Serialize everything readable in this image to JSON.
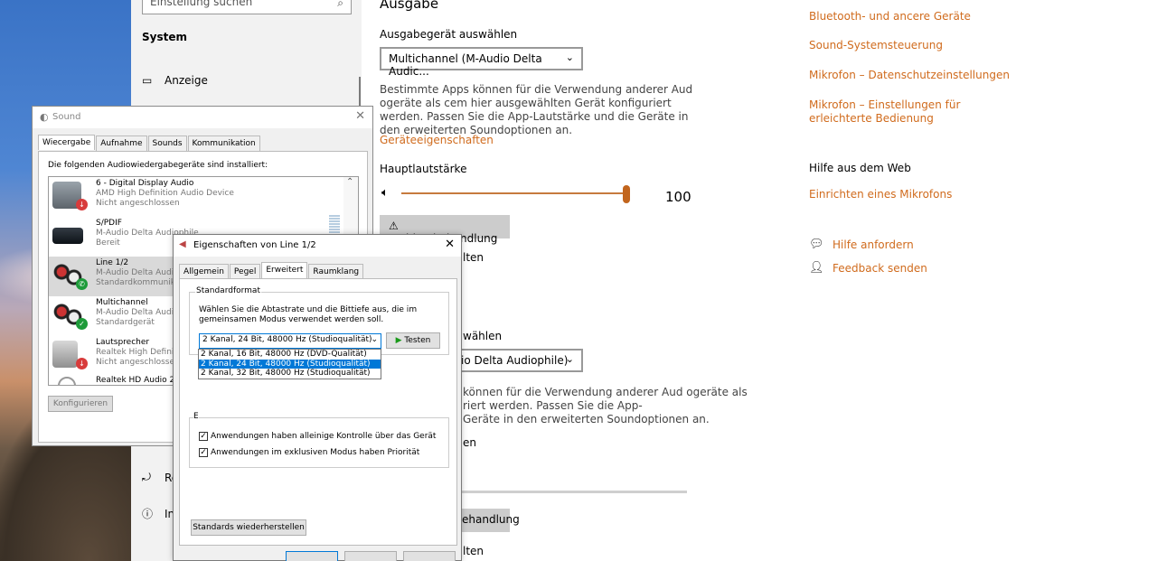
{
  "settings_nav": {
    "search_placeholder": "Einstellung suchen",
    "section": "System",
    "items": [
      {
        "label": "Anzeige",
        "icon": "monitor-icon"
      },
      {
        "label": "Re",
        "icon": "refresh-icon"
      },
      {
        "label": "In",
        "icon": "info-icon"
      }
    ]
  },
  "settings_main": {
    "heading": "Ausgabe",
    "output_device_label": "Ausgabegerät auswählen",
    "output_device_value": "Multichannel (M-Audio Delta Audic...",
    "apps_text": "Bestimmte Apps können für die Verwendung anderer Aud ogeräte als cem hier ausgewählten Gerät konfiguriert werden. Passen Sie die App-Lautstärke und die Geräte in den erweiterten Soundoptionen an.",
    "device_props_link": "Geräteeigenschaften",
    "master_volume_label": "Hauptlautstärke",
    "master_volume_value": "100",
    "master_volume_level": 100,
    "troubleshoot_button": "Problembehandlung",
    "frag_link1": "lten",
    "frag_select_label": "wählen",
    "input_device_value": "io Delta Audiophile)",
    "apps_text2_l1": "können für die Verwendung anderer Aud ogeräte als",
    "apps_text2_l2": "riert werden. Passen Sie die App-",
    "apps_text2_l3": "Geräte in den erweiterten Soundoptionen an.",
    "frag_link2": "en",
    "troubleshoot_button2_frag": "ehandlung",
    "frag_link3": "lten"
  },
  "settings_right": {
    "links": [
      "Bluetooth- und ancere Geräte",
      "Sound-Systemsteuerung",
      "Mikrofon – Datenschutzeinstellungen"
    ],
    "link_mic_easy_l1": "Mikrofon – Einstellungen für",
    "link_mic_easy_l2": "erleichterte Bedienung",
    "help_heading": "Hilfe aus dem Web",
    "help_link": "Einrichten eines Mikrofons",
    "get_help": "Hilfe anfordern",
    "feedback": "Feedback senden"
  },
  "sound_dialog": {
    "title": "Sound",
    "tabs": [
      "Wiecergabe",
      "Aufnahme",
      "Sounds",
      "Kommunikation"
    ],
    "intro": "Die folgenden Audiowiedergabegeräte sind installiert:",
    "devices": [
      {
        "name": "6 - Digital Display Audio",
        "desc": "AMD High Definition Audio Device",
        "status": "Nicht angeschlossen",
        "badge_color": "#d83b3b",
        "badge_icon": "down-arrow-icon"
      },
      {
        "name": "S/PDIF",
        "desc": "M-Audio Delta Audiophile",
        "status": "Bereit",
        "badge_color": "",
        "badge_icon": ""
      },
      {
        "name": "Line 1/2",
        "desc": "M-Audio Delta Audic",
        "status": "Standardkommunika",
        "badge_color": "#1e9b3a",
        "badge_icon": "phone-icon"
      },
      {
        "name": "Multichannel",
        "desc": "M-Audio Delta Audic",
        "status": "Standardgerät",
        "badge_color": "#1e9b3a",
        "badge_icon": "check-icon"
      },
      {
        "name": "Lautsprecher",
        "desc": "Realtek High Definit",
        "status": "Nicht angeschlossen",
        "badge_color": "#d83b3b",
        "badge_icon": "down-arrow-icon"
      },
      {
        "name": "Realtek HD Audio 2n",
        "desc": "",
        "status": "",
        "badge_color": "",
        "badge_icon": ""
      }
    ],
    "configure_button": "Konfigurieren"
  },
  "props_dialog": {
    "title": "Eigenschaften von Line 1/2",
    "tabs": [
      "Allgemein",
      "Pegel",
      "Erweitert",
      "Raumklang"
    ],
    "group_label": "Standardformat",
    "group_desc": "Wählen Sie die Abtastrate und die Bittiefe aus, die im gemeinsamen Modus verwendet werden soll.",
    "format_value": "2 Kanal, 24 Bit, 48000 Hz (Studioqualität)",
    "test_button": "Testen",
    "options": [
      "2 Kanal, 16 Bit, 48000 Hz (DVD-Qualität)",
      "2 Kanal, 24 Bit, 48000 Hz (Studioqualität)",
      "2 Kanal, 32 Bit, 48000 Hz (Studioqualität)"
    ],
    "selected_option": 1,
    "group2_label": "E",
    "checkbox1": "Anwendungen haben alleinige Kontrolle über das Gerät",
    "checkbox2": "Anwendungen im exklusiven Modus haben Priorität",
    "restore_button": "Standards wiederherstellen"
  }
}
